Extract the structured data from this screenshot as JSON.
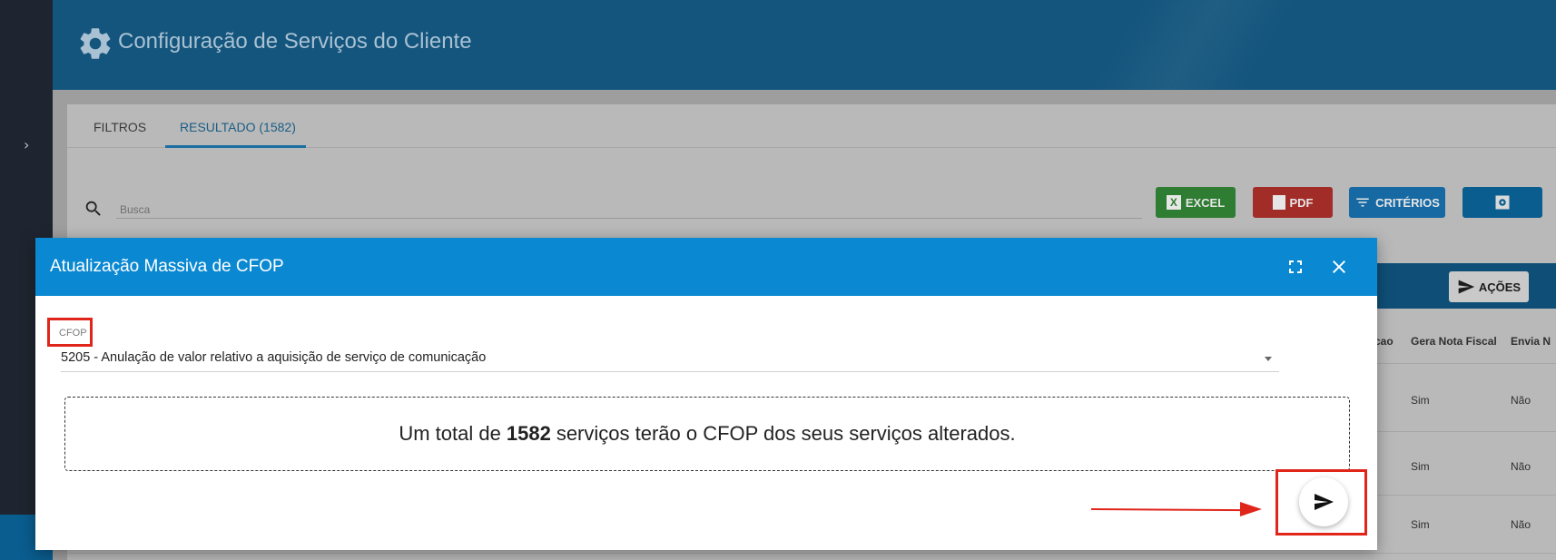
{
  "header": {
    "title": "Configuração de Serviços do Cliente"
  },
  "tabs": [
    {
      "label": "FILTROS"
    },
    {
      "label": "RESULTADO (1582)"
    }
  ],
  "search": {
    "placeholder": "Busca"
  },
  "toolbar": {
    "excel_label": "EXCEL",
    "pdf_label": "PDF",
    "criterios_label": "CRITÉRIOS",
    "acoes_label": "AÇÕES"
  },
  "table": {
    "columns": [
      "cao",
      "Gera Nota Fiscal",
      "Envia N"
    ],
    "rows": [
      [
        "Sim",
        "Não"
      ],
      [
        "Sim",
        "Não"
      ],
      [
        "Sim",
        "Não"
      ]
    ]
  },
  "dialog": {
    "title": "Atualização Massiva de CFOP",
    "field_label": "CFOP",
    "field_value": "5205 - Anulação de valor relativo a aquisição de serviço de comunicação",
    "info_prefix": "Um total de",
    "info_count": "1582",
    "info_suffix": "serviços terão o CFOP dos seus serviços alterados."
  },
  "icons": {
    "header": "gear-icon",
    "search": "search-icon",
    "send": "send-icon",
    "maximize": "maximize-icon",
    "close": "close-icon"
  },
  "colors": {
    "header_bg": "#14557d",
    "dialog_header": "#0a88d2",
    "excel": "#2e7d32",
    "pdf": "#a12c28",
    "criterios": "#1669a3",
    "annotation_red": "#e0251b"
  }
}
